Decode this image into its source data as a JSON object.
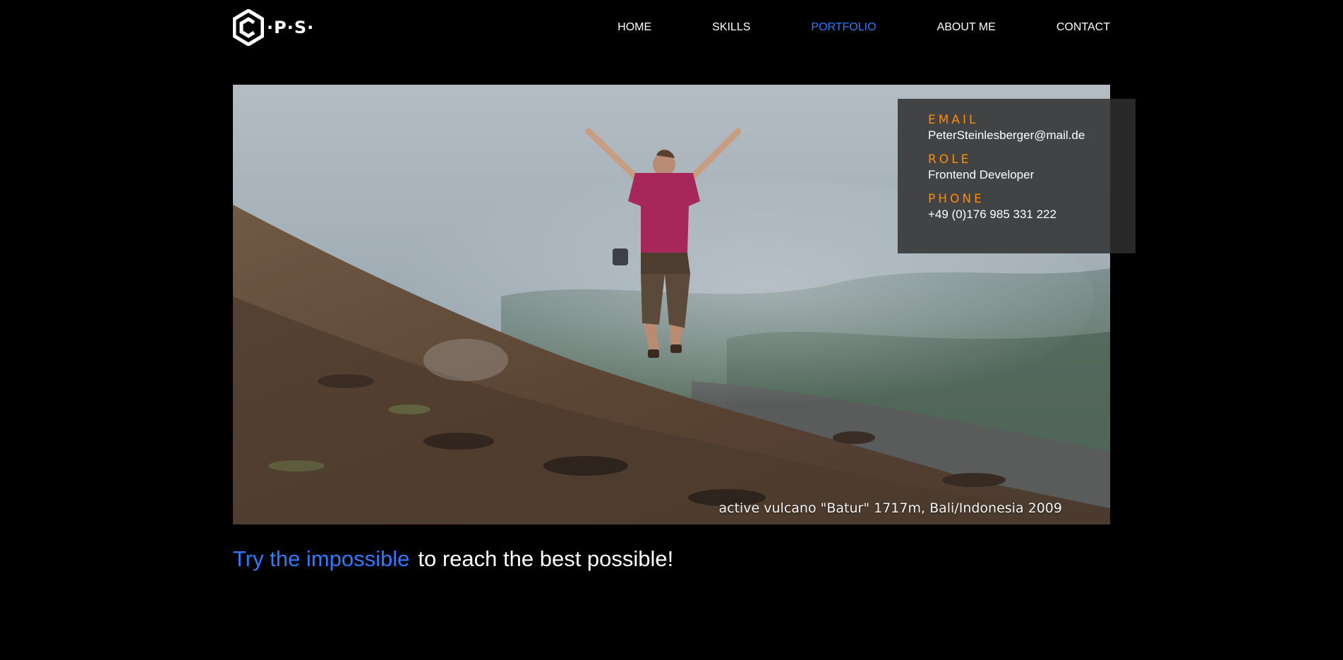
{
  "header": {
    "logo_text": "·P·S·",
    "nav": [
      {
        "label": "HOME",
        "active": false
      },
      {
        "label": "SKILLS",
        "active": false
      },
      {
        "label": "PORTFOLIO",
        "active": true
      },
      {
        "label": "ABOUT ME",
        "active": false
      },
      {
        "label": "CONTACT",
        "active": false
      }
    ]
  },
  "hero": {
    "caption": "active vulcano \"Batur\" 1717m, Bali/Indonesia 2009"
  },
  "info": {
    "email_label": "EMAIL",
    "email_value": "PeterSteinlesberger@mail.de",
    "role_label": "ROLE",
    "role_value": "Frontend Developer",
    "phone_label": "PHONE",
    "phone_value": "+49 (0)176 985 331 222"
  },
  "tagline": {
    "highlight": "Try the impossible",
    "rest": "to reach the best possible!"
  },
  "colors": {
    "accent_blue": "#2f7bff",
    "label_orange": "#ff8c00",
    "background": "#000000"
  }
}
